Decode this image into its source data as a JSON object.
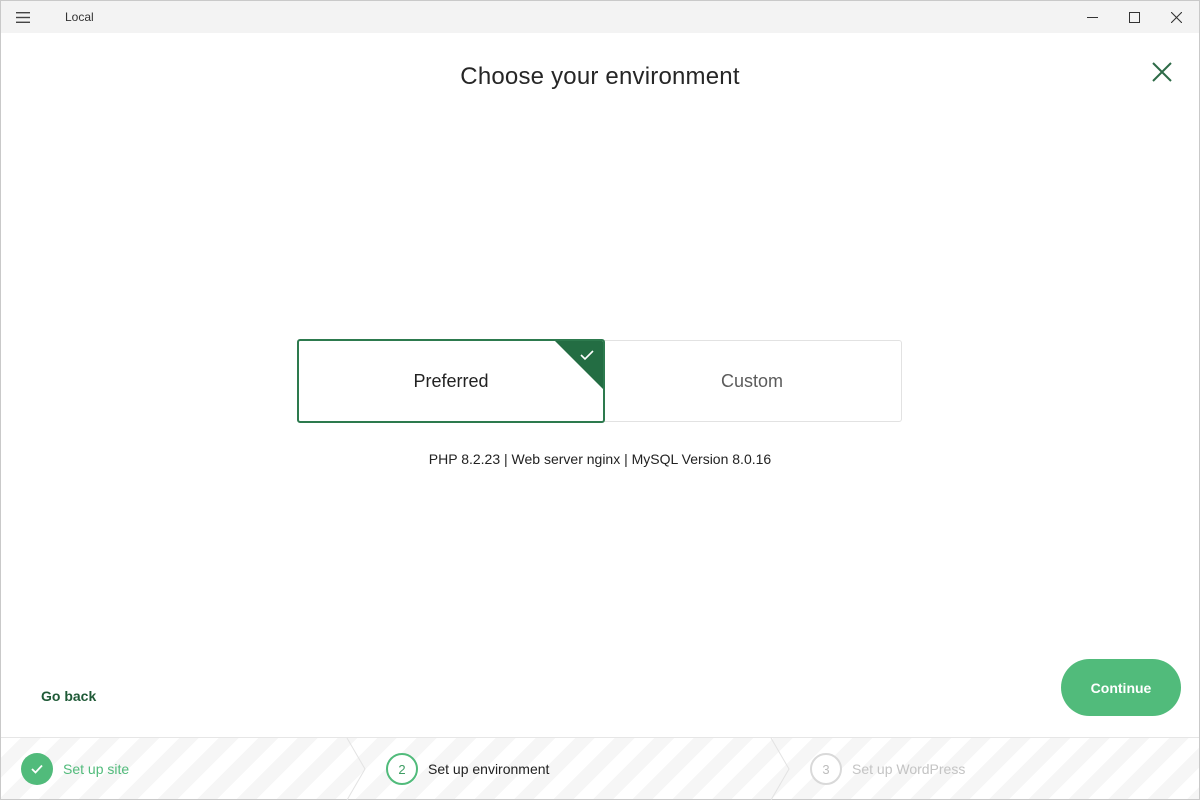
{
  "window": {
    "title": "Local"
  },
  "page": {
    "title": "Choose your environment"
  },
  "environment": {
    "options": [
      {
        "label": "Preferred",
        "selected": true
      },
      {
        "label": "Custom",
        "selected": false
      }
    ],
    "description": "PHP 8.2.23 | Web server nginx | MySQL Version 8.0.16"
  },
  "actions": {
    "back_label": "Go back",
    "continue_label": "Continue"
  },
  "steps": [
    {
      "number": "1",
      "label": "Set up site",
      "status": "done"
    },
    {
      "number": "2",
      "label": "Set up environment",
      "status": "active"
    },
    {
      "number": "3",
      "label": "Set up WordPress",
      "status": "todo"
    }
  ],
  "colors": {
    "accent": "#51bb7b",
    "accent_dark": "#236d43",
    "text": "#222222",
    "muted": "#c4c4c4"
  }
}
